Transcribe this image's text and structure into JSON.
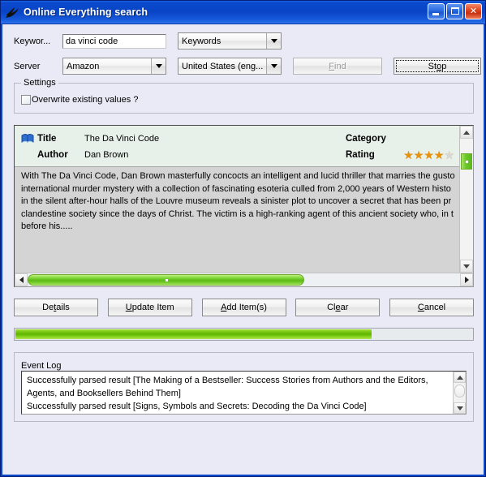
{
  "window": {
    "title": "Online Everything search",
    "icon": "bird-icon",
    "controls": {
      "minimize": "minimize-button",
      "maximize": "maximize-button",
      "close": "close-button"
    }
  },
  "form": {
    "keyword_label": "Keywor...",
    "keyword_value": "da vinci code",
    "keyword_placeholder": "",
    "search_type": "Keywords",
    "server_label": "Server",
    "server_value": "Amazon",
    "locale_value": "United States (eng...",
    "find_label": "Find",
    "find_mnemonic": "F",
    "stop_label": "Stop",
    "stop_mnemonic": "o"
  },
  "settings": {
    "group_title": "Settings",
    "overwrite_label": "Overwrite existing values ?",
    "overwrite_checked": false
  },
  "result": {
    "title_label": "Title",
    "title_value": "The Da Vinci Code",
    "author_label": "Author",
    "author_value": "Dan Brown",
    "category_label": "Category",
    "category_value": "",
    "rating_label": "Rating",
    "rating_filled": 4,
    "rating_total": 5,
    "description": [
      "With The Da Vinci Code, Dan Brown masterfully concocts an intelligent and lucid thriller that marries the gusto",
      "international murder mystery with a collection of fascinating esoteria culled from 2,000 years of Western histo",
      "in the silent after-hour halls of the Louvre museum reveals a sinister plot to uncover a secret that has been pr",
      "clandestine society since the days of Christ. The victim is a high-ranking agent of this ancient society who, in t",
      "before his....."
    ]
  },
  "actions": [
    {
      "label": "Details",
      "pre": "De",
      "mn": "t",
      "post": "ails"
    },
    {
      "label": "Update Item",
      "pre": "",
      "mn": "U",
      "post": "pdate Item"
    },
    {
      "label": "Add Item(s)",
      "pre": "",
      "mn": "A",
      "post": "dd Item(s)"
    },
    {
      "label": "Clear",
      "pre": "Cl",
      "mn": "e",
      "post": "ar"
    },
    {
      "label": "Cancel",
      "pre": "",
      "mn": "C",
      "post": "ancel"
    }
  ],
  "progress": {
    "percent": 78
  },
  "event_log": {
    "group_title": "Event Log",
    "lines": [
      "Successfully parsed result [The Making of a Bestseller: Success Stories from Authors and the Editors,",
      "Agents, and Booksellers Behind Them]",
      "Successfully parsed result [Signs, Symbols and Secrets: Decoding the Da Vinci Code]"
    ]
  },
  "colors": {
    "titlebar": "#0a46c8",
    "client": "#e9eaf5",
    "progress": "#5fb500",
    "star": "#e8920c",
    "scroll_thumb": "#5cbb18"
  }
}
